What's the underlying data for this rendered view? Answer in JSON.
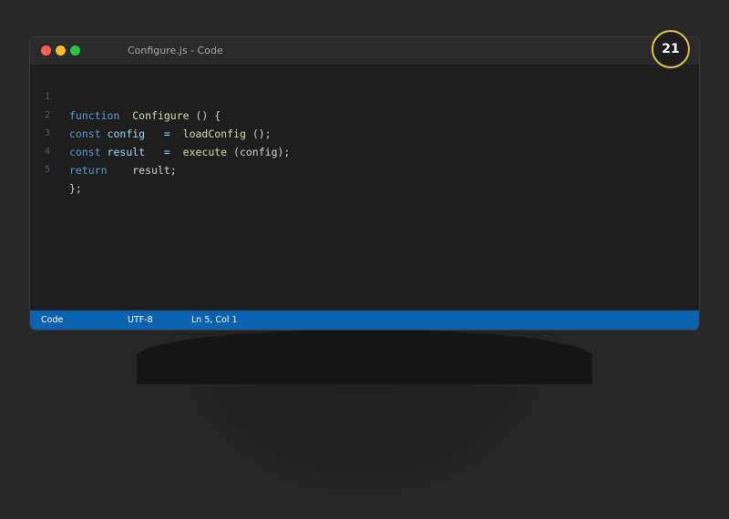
{
  "window": {
    "title": "Configure.js - Code",
    "controls": [
      "close",
      "minimize",
      "maximize"
    ]
  },
  "editor": {
    "lines": [
      {
        "number": "1",
        "tokens": [
          {
            "text": "function",
            "kind": "keyword"
          },
          {
            "text": "  ",
            "kind": "plain"
          },
          {
            "text": "Configure",
            "kind": "function"
          },
          {
            "text": " () {",
            "kind": "plain"
          }
        ]
      },
      {
        "number": "2",
        "tokens": [
          {
            "text": "const",
            "kind": "keyword"
          },
          {
            "text": " config   =  ",
            "kind": "plain"
          },
          {
            "text": "loadConfig",
            "kind": "function"
          },
          {
            "text": " ();",
            "kind": "plain"
          }
        ]
      },
      {
        "number": "3",
        "tokens": [
          {
            "text": "const",
            "kind": "keyword"
          },
          {
            "text": " result   =  ",
            "kind": "plain"
          },
          {
            "text": "execute",
            "kind": "function"
          },
          {
            "text": " (config);",
            "kind": "plain"
          }
        ]
      },
      {
        "number": "4",
        "tokens": [
          {
            "text": "return",
            "kind": "keyword"
          },
          {
            "text": "    result;",
            "kind": "plain"
          }
        ]
      },
      {
        "number": "5",
        "tokens": [
          {
            "text": "};",
            "kind": "plain"
          }
        ]
      }
    ]
  },
  "statusbar": {
    "mode": "Code",
    "encoding": "UTF-8",
    "cursor": "Ln 5, Col 1"
  },
  "badge": {
    "number": "21"
  },
  "colors": {
    "keyword": "#569cd6",
    "function": "#dcdcaa",
    "plain": "#d4d4d4",
    "statusbar": "#0a62b0",
    "badge_ring": "#e3c24a"
  }
}
